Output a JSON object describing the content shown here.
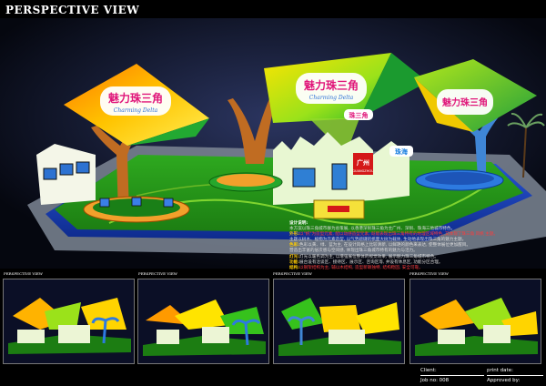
{
  "page": {
    "title": "PERSPECTIVE VIEW"
  },
  "main_signage": {
    "left_sign": {
      "chinese": "魅力珠三角",
      "english": "Charming Delta"
    },
    "center_sign": {
      "chinese": "魅力珠三角",
      "english": "Charming Delta"
    },
    "right_sign": {
      "chinese": "魅力珠三角"
    },
    "small_sign_1": "珠三角",
    "small_sign_2": "珠海",
    "small_sign_3": "广州",
    "small_sign_3_en": "GUANGZHOU"
  },
  "notes": {
    "heading": "设计说明:",
    "lines": [
      {
        "label": "",
        "text": "本方案以珠三角城市群为总策展, 以香港深圳珠三角为主广州、深圳、珠海三地城市特色。"
      },
      {
        "label": "外形:",
        "text": "以\"帆\"为造型元素, 配以动感造型元素, 既能表现出珠三角特有的地理区域特色, 又体现了珠三角 风帆 主题。",
        "highlight": true
      },
      {
        "label": "",
        "text": "主题以树木、植物为元素造型, 以气势磅礴的帆面大树为载体, 生动地表现出珠三角的魅力主题。"
      },
      {
        "label": "色彩:",
        "text": "色彩以黄、绿、蓝为主, 在设计风格上比较清新, 以鲜艳的颜色来表达, 使整体展位更加醒目。"
      },
      {
        "label": "",
        "text": "营造出丰富的层次感与空间感, 体现出珠三角城市特有的魅力与活力。"
      },
      {
        "label": "灯光:",
        "text": "灯光以暖色调为主, 以增强展位整体的视觉效果, 展示魅力珠三角城市特色。"
      },
      {
        "label": "功能:",
        "text": "展台设有洽谈区、接待区、展示区、咨询区等, 并设有休息区, 功能分区合理。"
      },
      {
        "label": "结构:",
        "text": "以钢架结构为主, 辅以木结构, 造型新颖独特, 结构稳固, 安全可靠。",
        "highlight": true
      }
    ]
  },
  "thumbnails": [
    {
      "label": "PERSPECTIVE VIEW"
    },
    {
      "label": "PERSPECTIVE VIEW"
    },
    {
      "label": "PERSPECTIVE VIEW"
    },
    {
      "label": "PERSPECTIVE VIEW"
    }
  ],
  "footer": {
    "client_label": "Client:",
    "job_label": "Job no: 008",
    "print_date_label": "print date:",
    "approved_label": "Approved by:"
  },
  "colors": {
    "background": "#000000",
    "accent_yellow": "#ffd400",
    "accent_green": "#36c21c",
    "accent_blue": "#1d7fe0",
    "floor_blue": "#1a3fbf"
  }
}
